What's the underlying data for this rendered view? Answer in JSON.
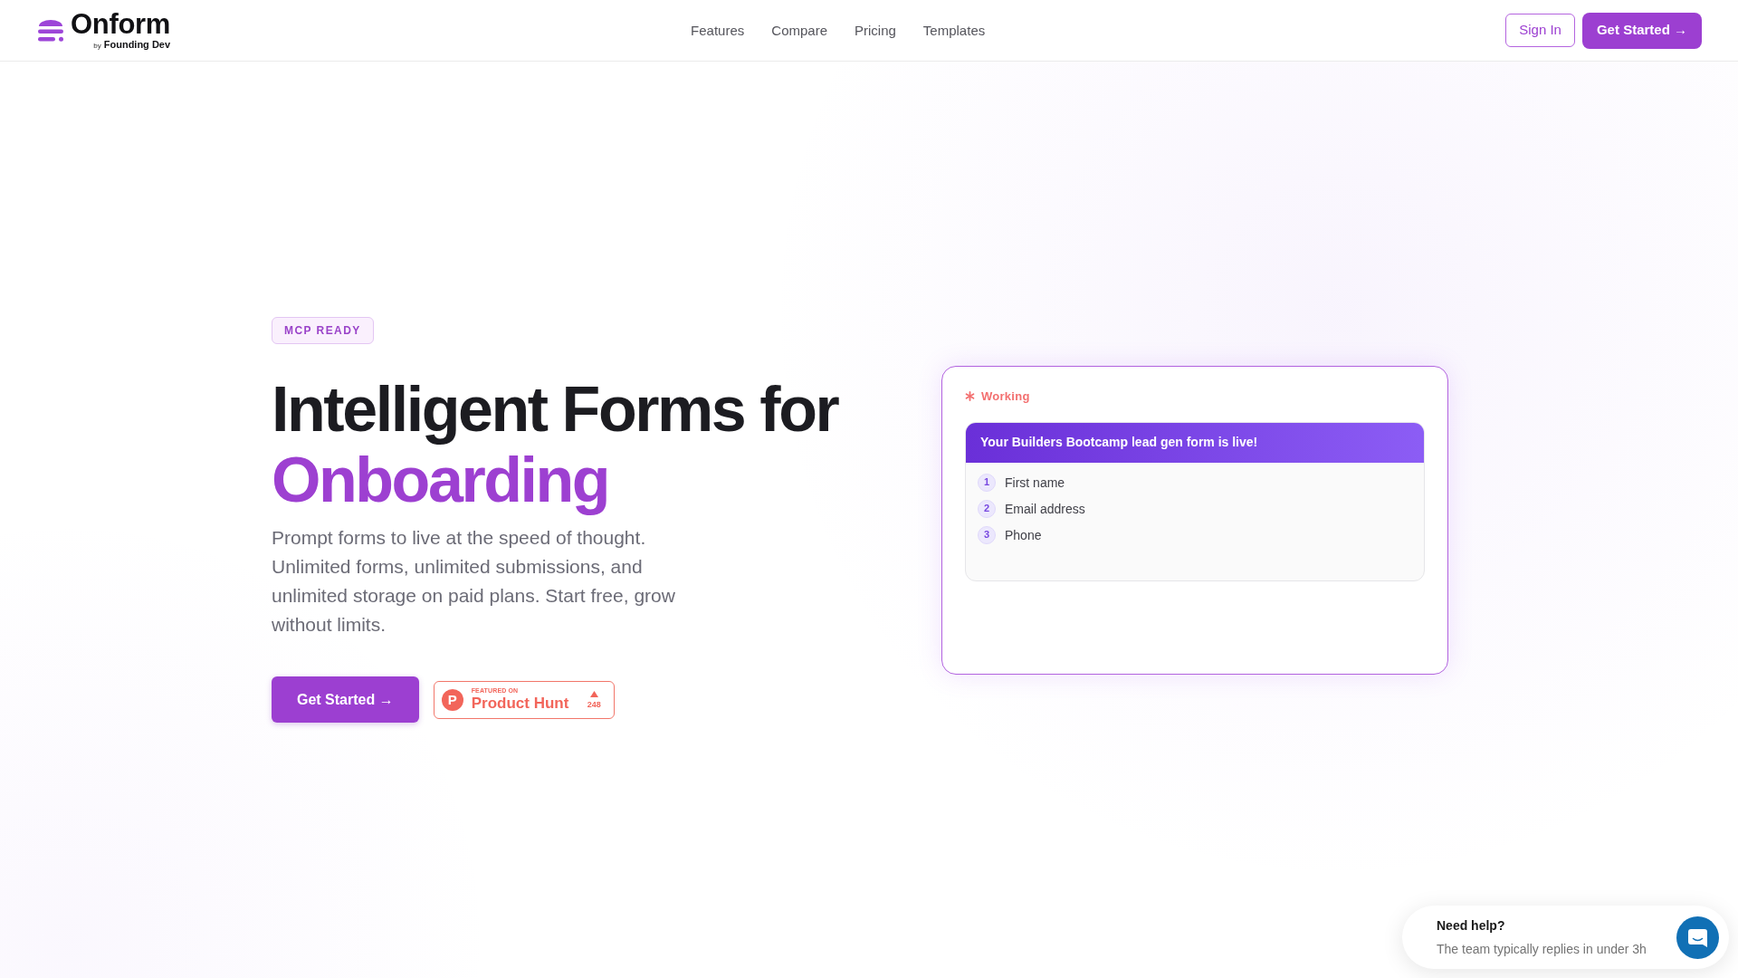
{
  "header": {
    "logo": {
      "name": "Onform",
      "byline_prefix": "by",
      "byline": "Founding Dev"
    },
    "nav": [
      "Features",
      "Compare",
      "Pricing",
      "Templates"
    ],
    "sign_in": "Sign In",
    "get_started": "Get Started →"
  },
  "hero": {
    "badge": "MCP READY",
    "heading": "Intelligent Forms for",
    "heading_highlight": "Onboarding",
    "description": "Prompt forms to live at the speed of thought. Unlimited forms, unlimited submissions, and unlimited storage on paid plans. Start free, grow without limits.",
    "cta": "Get Started →",
    "product_hunt": {
      "logo_letter": "P",
      "kicker": "FEATURED ON",
      "name": "Product Hunt",
      "votes": "248"
    }
  },
  "preview": {
    "status": "Working",
    "banner": "Your Builders Bootcamp lead gen form is live!",
    "fields": [
      {
        "number": "1",
        "label": "First name"
      },
      {
        "number": "2",
        "label": "Email address"
      },
      {
        "number": "3",
        "label": "Phone"
      }
    ]
  },
  "chat_widget": {
    "title": "Need help?",
    "subtitle": "The team typically replies in under 3h"
  }
}
